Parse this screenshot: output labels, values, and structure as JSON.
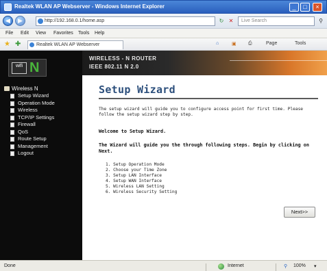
{
  "window": {
    "title": "Realtek WLAN AP Webserver - Windows Internet Explorer",
    "minimize": "_",
    "maximize": "□",
    "close": "×"
  },
  "address_bar": {
    "url": "http://192.168.0.1/home.asp",
    "search_placeholder": "Live Search"
  },
  "menu": [
    "File",
    "Edit",
    "View",
    "Favorites",
    "Tools",
    "Help"
  ],
  "favorites_bar": {
    "tab_title": "Realtek WLAN AP Webserver",
    "tools": [
      "Page",
      "Tools"
    ]
  },
  "sidebar": {
    "logo_wifi": "wifi",
    "logo_letter": "N",
    "root": "Wireless N",
    "items": [
      "Setup Wizard",
      "Operation Mode",
      "Wireless",
      "TCP/IP Settings",
      "Firewall",
      "QoS",
      "Route Setup",
      "Management",
      "Logout"
    ]
  },
  "banner": {
    "line1": "WIRELESS - N ROUTER",
    "line2": "IEEE 802.11 N 2.0"
  },
  "content": {
    "heading": "Setup Wizard",
    "intro": "The setup wizard will guide you to configure access point for first time. Please follow the setup wizard step by step.",
    "welcome": "Welcome to Setup Wizard.",
    "guide": "The Wizard will guide you the through following steps. Begin by clicking on Next.",
    "steps": [
      "1. Setup Operation Mode",
      "2. Choose your Time Zone",
      "3. Setup LAN Interface",
      "4. Setup WAN Interface",
      "5. Wireless LAN Setting",
      "6. Wireless Security Setting"
    ],
    "next_button": "Next>>"
  },
  "status_bar": {
    "left": "Done",
    "zone": "Internet",
    "zoom": "100%"
  }
}
